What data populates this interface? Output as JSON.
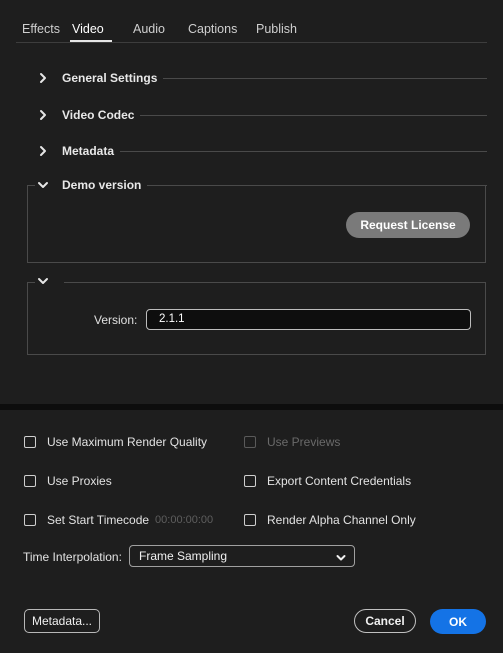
{
  "tabs": [
    {
      "label": "Effects"
    },
    {
      "label": "Video"
    },
    {
      "label": "Audio"
    },
    {
      "label": "Captions"
    },
    {
      "label": "Publish"
    }
  ],
  "sections": {
    "general_settings": "General Settings",
    "video_codec": "Video Codec",
    "metadata": "Metadata",
    "demo_version": "Demo version"
  },
  "demo": {
    "request_license_label": "Request License"
  },
  "version": {
    "label": "Version:",
    "value": "2.1.1"
  },
  "options": {
    "use_max_render_quality": "Use Maximum Render Quality",
    "use_previews": "Use Previews",
    "use_proxies": "Use Proxies",
    "export_content_credentials": "Export Content Credentials",
    "set_start_timecode": "Set Start Timecode",
    "start_timecode_value": "00:00:00:00",
    "render_alpha_only": "Render Alpha Channel Only"
  },
  "time_interpolation": {
    "label": "Time Interpolation:",
    "selected": "Frame Sampling"
  },
  "footer": {
    "metadata_button": "Metadata...",
    "cancel_button": "Cancel",
    "ok_button": "OK"
  },
  "colors": {
    "background": "#1e1e1e",
    "accent": "#1473e6",
    "license_button": "#7a7a7a"
  }
}
